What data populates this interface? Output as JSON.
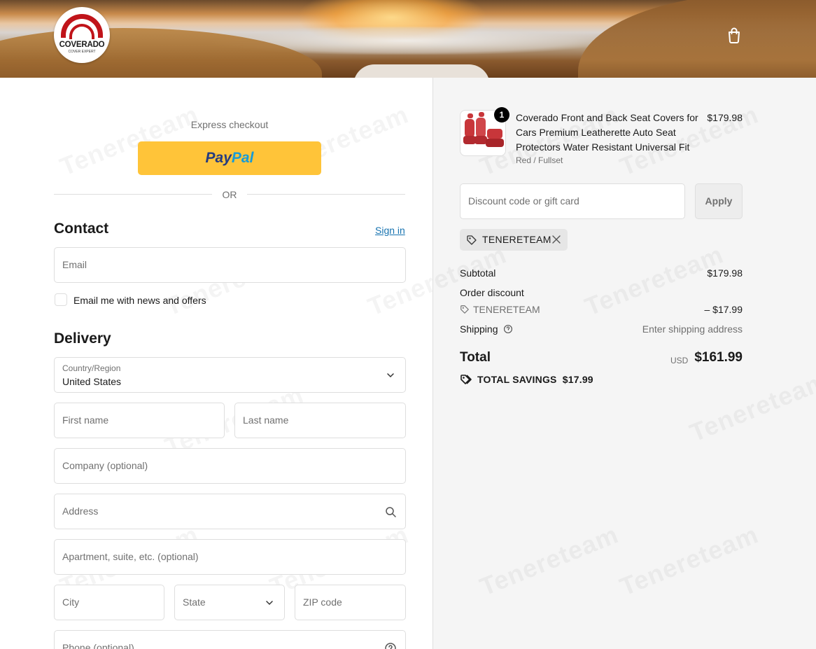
{
  "header": {
    "logo": {
      "brand": "COVERADO",
      "tagline": "COVER EXPERT"
    },
    "cart_icon": "shopping-bag-icon"
  },
  "express": {
    "label": "Express checkout",
    "paypal": {
      "pay": "Pay",
      "pal": "Pal"
    },
    "or_text": "OR"
  },
  "contact": {
    "title": "Contact",
    "sign_in": "Sign in",
    "email_placeholder": "Email",
    "newsletter_label": "Email me with news and offers",
    "newsletter_checked": false
  },
  "delivery": {
    "title": "Delivery",
    "country_label": "Country/Region",
    "country_value": "United States",
    "first_name": "First name",
    "last_name": "Last name",
    "company": "Company (optional)",
    "address": "Address",
    "apartment": "Apartment, suite, etc. (optional)",
    "city": "City",
    "state": "State",
    "zip": "ZIP code",
    "phone": "Phone (optional)"
  },
  "order": {
    "item": {
      "quantity": "1",
      "title": "Coverado Front and Back Seat Covers for Cars Premium Leatherette Auto Seat Protectors Water Resistant Universal Fit",
      "variant": "Red / Fullset",
      "price": "$179.98"
    },
    "discount_placeholder": "Discount code or gift card",
    "apply_label": "Apply",
    "applied_code": "TENERETEAM",
    "subtotal_label": "Subtotal",
    "subtotal_value": "$179.98",
    "order_discount_label": "Order discount",
    "discount_code": "TENERETEAM",
    "discount_value": "– $17.99",
    "shipping_label": "Shipping",
    "shipping_value": "Enter shipping address",
    "total_label": "Total",
    "currency": "USD",
    "total_value": "$161.99",
    "savings_label": "TOTAL SAVINGS",
    "savings_value": "$17.99"
  },
  "watermark": "Tenereteam"
}
